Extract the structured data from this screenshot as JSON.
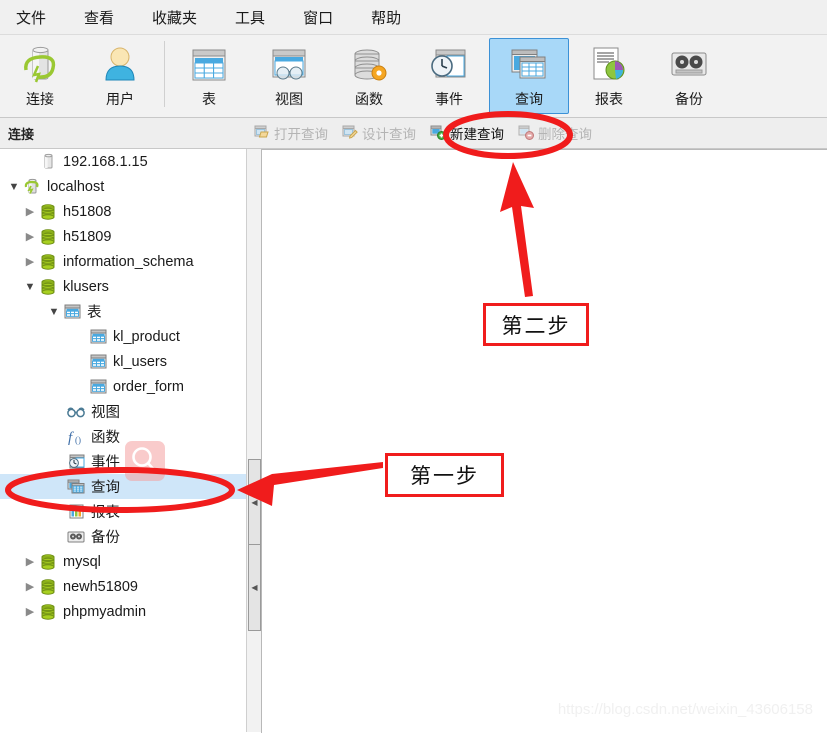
{
  "menubar": {
    "items": [
      {
        "label": "文件",
        "name": "menu-file"
      },
      {
        "label": "查看",
        "name": "menu-view"
      },
      {
        "label": "收藏夹",
        "name": "menu-favorites"
      },
      {
        "label": "工具",
        "name": "menu-tools"
      },
      {
        "label": "窗口",
        "name": "menu-window"
      },
      {
        "label": "帮助",
        "name": "menu-help"
      }
    ]
  },
  "toolbar": {
    "buttons": [
      {
        "label": "连接",
        "icon": "connection-icon",
        "selected": false
      },
      {
        "label": "用户",
        "icon": "user-icon",
        "selected": false
      },
      {
        "label": "表",
        "icon": "table-icon",
        "selected": false
      },
      {
        "label": "视图",
        "icon": "view-icon",
        "selected": false
      },
      {
        "label": "函数",
        "icon": "function-icon",
        "selected": false
      },
      {
        "label": "事件",
        "icon": "event-icon",
        "selected": false
      },
      {
        "label": "查询",
        "icon": "query-icon",
        "selected": true
      },
      {
        "label": "报表",
        "icon": "report-icon",
        "selected": false
      },
      {
        "label": "备份",
        "icon": "backup-icon",
        "selected": false
      }
    ]
  },
  "subbar": {
    "title": "连接",
    "buttons": [
      {
        "label": "打开查询",
        "icon": "open-query-icon",
        "enabled": false
      },
      {
        "label": "设计查询",
        "icon": "design-query-icon",
        "enabled": false
      },
      {
        "label": "新建查询",
        "icon": "new-query-icon",
        "enabled": true
      },
      {
        "label": "删除查询",
        "icon": "delete-query-icon",
        "enabled": false
      }
    ]
  },
  "tree": {
    "rows": [
      {
        "label": "192.168.1.15",
        "icon": "server-offline-icon",
        "indent": 1,
        "chev": "",
        "selected": false
      },
      {
        "label": "localhost",
        "icon": "server-connected-icon",
        "indent": 0,
        "chev": "open",
        "selected": false
      },
      {
        "label": "h51808",
        "icon": "database-icon",
        "indent": 1,
        "chev": "closed",
        "selected": false
      },
      {
        "label": "h51809",
        "icon": "database-icon",
        "indent": 1,
        "chev": "closed",
        "selected": false
      },
      {
        "label": "information_schema",
        "icon": "database-icon",
        "indent": 1,
        "chev": "closed",
        "selected": false
      },
      {
        "label": "klusers",
        "icon": "database-icon",
        "indent": 1,
        "chev": "open",
        "selected": false
      },
      {
        "label": "表",
        "icon": "table-icon",
        "indent": 2,
        "chev": "open",
        "selected": false
      },
      {
        "label": "kl_product",
        "icon": "table-icon",
        "indent": 4,
        "chev": "",
        "selected": false
      },
      {
        "label": "kl_users",
        "icon": "table-icon",
        "indent": 4,
        "chev": "",
        "selected": false
      },
      {
        "label": "order_form",
        "icon": "table-icon",
        "indent": 4,
        "chev": "",
        "selected": false
      },
      {
        "label": "视图",
        "icon": "view-icon",
        "indent": 3,
        "chev": "",
        "selected": false
      },
      {
        "label": "函数",
        "icon": "function-icon",
        "indent": 3,
        "chev": "",
        "selected": false
      },
      {
        "label": "事件",
        "icon": "event-icon",
        "indent": 3,
        "chev": "",
        "selected": false
      },
      {
        "label": "查询",
        "icon": "query-icon",
        "indent": 3,
        "chev": "",
        "selected": true
      },
      {
        "label": "报表",
        "icon": "report-icon",
        "indent": 3,
        "chev": "",
        "selected": false
      },
      {
        "label": "备份",
        "icon": "backup-icon",
        "indent": 3,
        "chev": "",
        "selected": false
      },
      {
        "label": "mysql",
        "icon": "database-icon",
        "indent": 1,
        "chev": "closed",
        "selected": false
      },
      {
        "label": "newh51809",
        "icon": "database-icon",
        "indent": 1,
        "chev": "closed",
        "selected": false
      },
      {
        "label": "phpmyadmin",
        "icon": "database-icon",
        "indent": 1,
        "chev": "closed",
        "selected": false
      }
    ]
  },
  "annotations": {
    "step_one": "第一步",
    "step_two": "第二步",
    "accent_color": "#f01c1c"
  },
  "watermark": "https://blog.csdn.net/weixin_43606158"
}
